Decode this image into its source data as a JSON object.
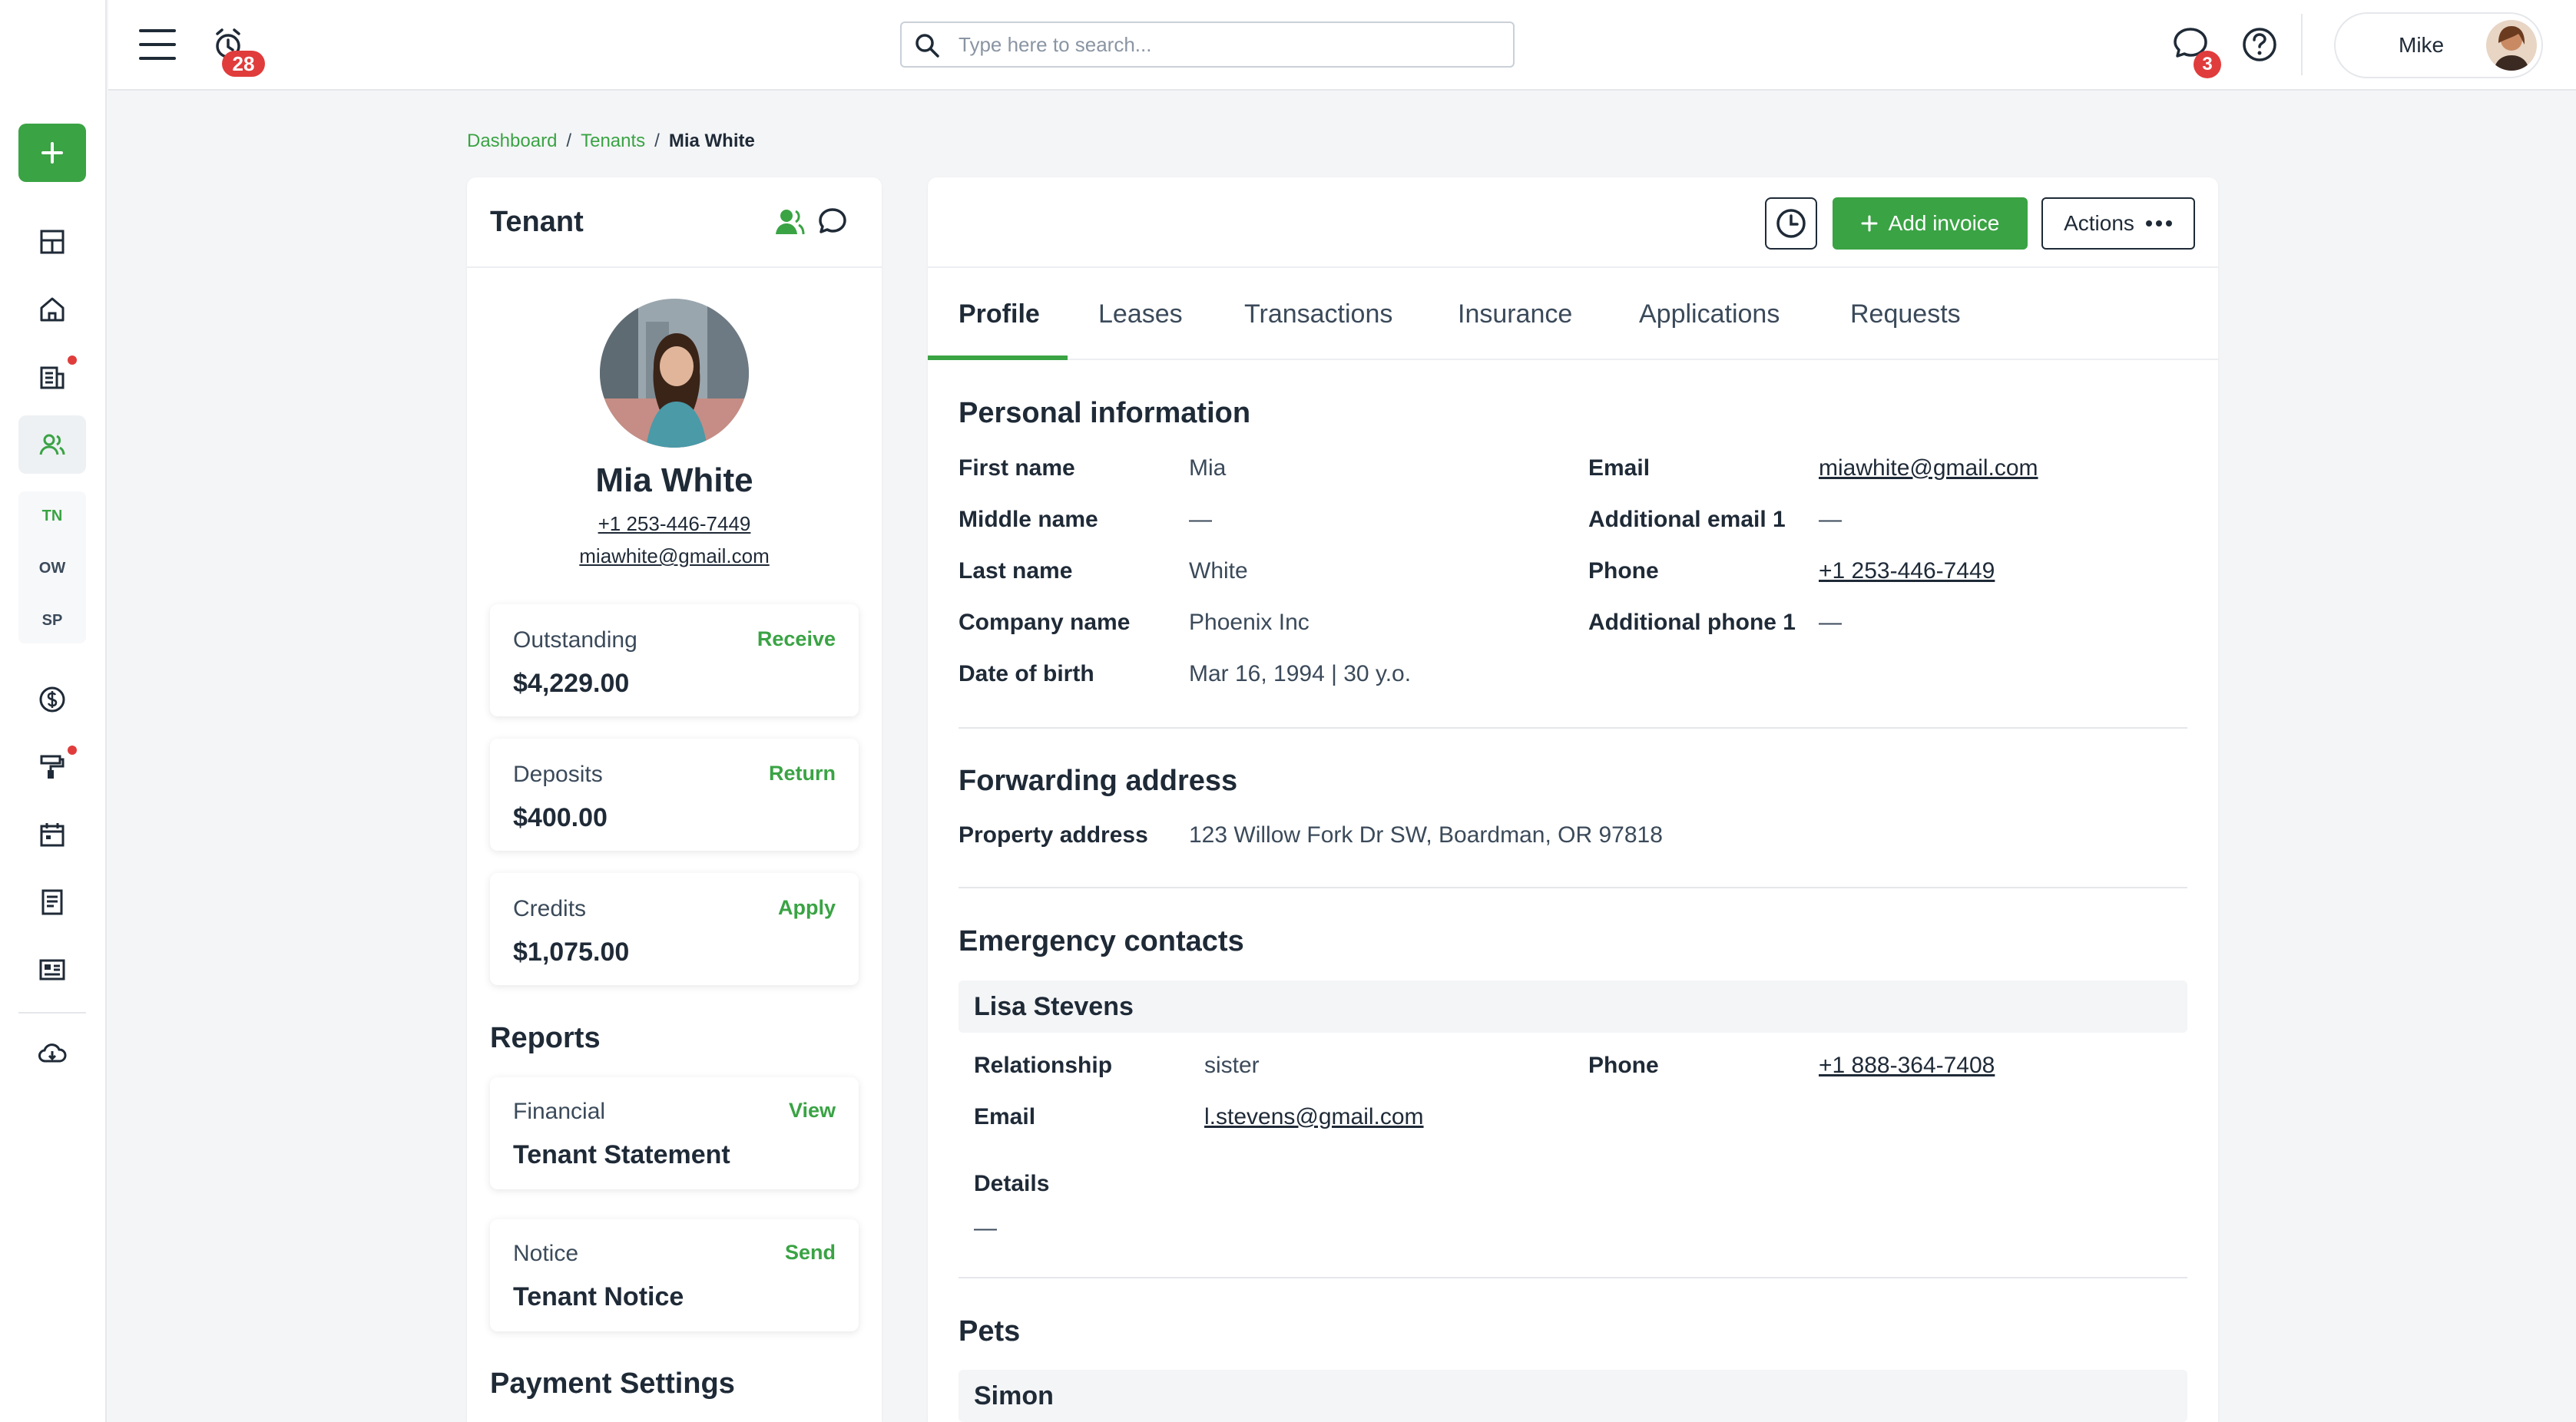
{
  "header": {
    "alarm_count": "28",
    "search_placeholder": "Type here to search...",
    "messages_count": "3",
    "user_name": "Mike"
  },
  "sidebar": {
    "sub_items": [
      "TN",
      "OW",
      "SP"
    ]
  },
  "breadcrumb": {
    "items": [
      "Dashboard",
      "Tenants"
    ],
    "current": "Mia White"
  },
  "tenant_card": {
    "title": "Tenant",
    "name": "Mia White",
    "phone": "+1 253-446-7449",
    "email": "miawhite@gmail.com",
    "balances": [
      {
        "label": "Outstanding",
        "action": "Receive",
        "value": "$4,229.00"
      },
      {
        "label": "Deposits",
        "action": "Return",
        "value": "$400.00"
      },
      {
        "label": "Credits",
        "action": "Apply",
        "value": "$1,075.00"
      }
    ],
    "reports_title": "Reports",
    "reports": [
      {
        "label": "Financial",
        "action": "View",
        "value": "Tenant Statement"
      },
      {
        "label": "Notice",
        "action": "Send",
        "value": "Tenant Notice"
      }
    ],
    "payment_settings_title": "Payment Settings"
  },
  "toolbar": {
    "add_invoice_label": "Add invoice",
    "actions_label": "Actions"
  },
  "tabs": [
    "Profile",
    "Leases",
    "Transactions",
    "Insurance",
    "Applications",
    "Requests"
  ],
  "personal": {
    "title": "Personal information",
    "first_name_label": "First name",
    "first_name": "Mia",
    "middle_name_label": "Middle name",
    "middle_name": "—",
    "last_name_label": "Last name",
    "last_name": "White",
    "company_label": "Company name",
    "company": "Phoenix Inc",
    "dob_label": "Date of birth",
    "dob": "Mar 16, 1994 | 30 y.o.",
    "email_label": "Email",
    "email": "miawhite@gmail.com",
    "add_email_label": "Additional email 1",
    "add_email": "—",
    "phone_label": "Phone",
    "phone": "+1 253-446-7449",
    "add_phone_label": "Additional phone 1",
    "add_phone": "—"
  },
  "forwarding": {
    "title": "Forwarding address",
    "property_label": "Property address",
    "property": "123 Willow Fork Dr SW, Boardman, OR 97818"
  },
  "emergency": {
    "title": "Emergency contacts",
    "contact_name": "Lisa Stevens",
    "relationship_label": "Relationship",
    "relationship": "sister",
    "phone_label": "Phone",
    "phone": "+1 888-364-7408",
    "email_label": "Email",
    "email": "l.stevens@gmail.com",
    "details_label": "Details",
    "details": "—"
  },
  "pets": {
    "title": "Pets",
    "pet_name": "Simon"
  }
}
